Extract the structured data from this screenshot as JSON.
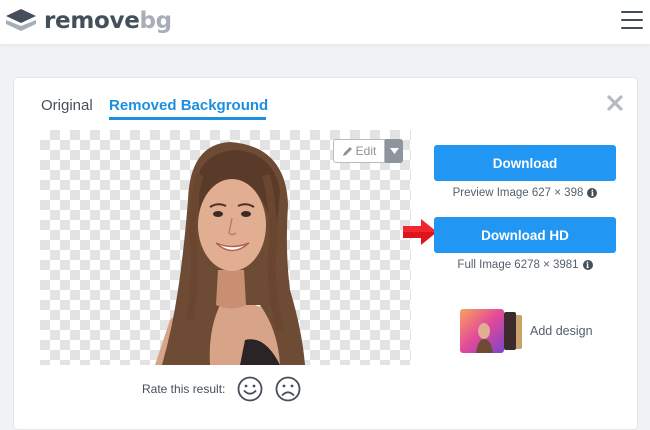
{
  "header": {
    "logo_word_1": "remove",
    "logo_word_2": "bg",
    "menu_icon": "hamburger-icon"
  },
  "tabs": [
    {
      "label": "Original",
      "active": false
    },
    {
      "label": "Removed Background",
      "active": true
    }
  ],
  "editor": {
    "edit_label": "Edit",
    "edit_icon": "pencil-icon",
    "dropdown_icon": "caret-down-icon"
  },
  "downloads": {
    "download_label": "Download",
    "preview_info": "Preview Image 627 × 398",
    "download_hd_label": "Download HD",
    "full_info": "Full Image 6278 × 3981",
    "info_icon": "info-icon"
  },
  "add_design": {
    "label": "Add design"
  },
  "rating": {
    "label": "Rate this result:",
    "good_icon": "smile-icon",
    "bad_icon": "frown-icon"
  },
  "colors": {
    "accent": "#2196f3",
    "tab_active": "#1d8fe1",
    "text": "#454f5b",
    "arrow": "#e0121b"
  }
}
